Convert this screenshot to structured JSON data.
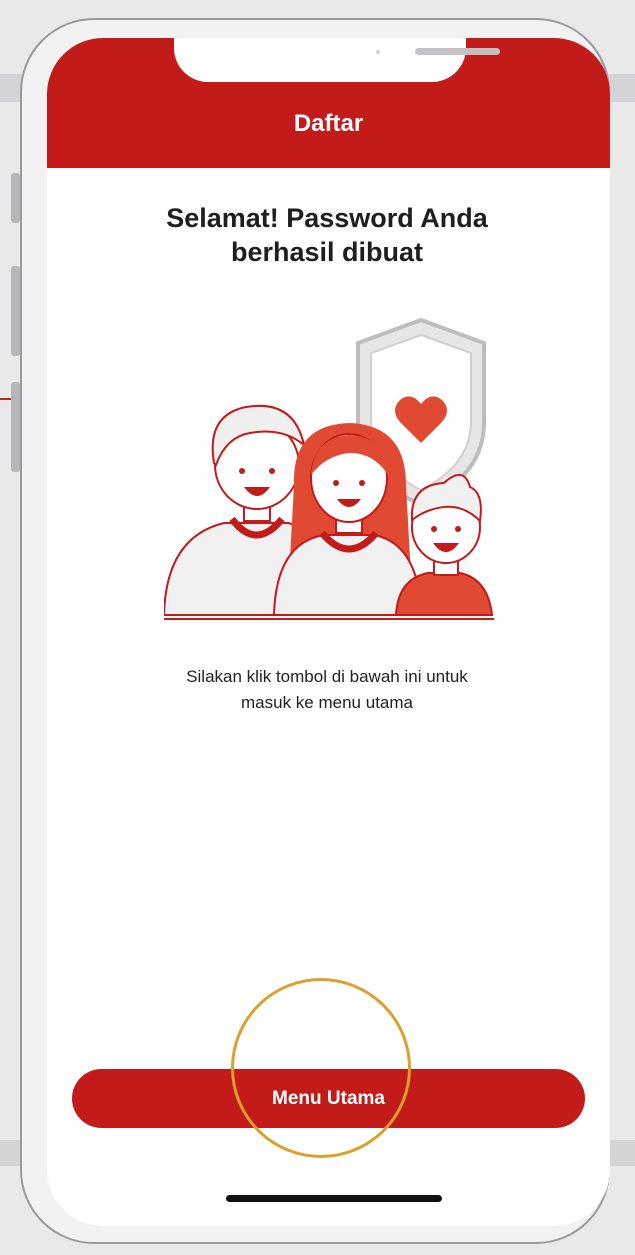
{
  "header": {
    "title": "Daftar"
  },
  "content": {
    "title_line1": "Selamat! Password Anda",
    "title_line2": "berhasil dibuat",
    "instruction_line1": "Silakan klik tombol di bawah ini untuk",
    "instruction_line2": "masuk ke menu utama"
  },
  "cta": {
    "label": "Menu Utama"
  },
  "colors": {
    "brand_red": "#c31a1a",
    "highlight_ring": "#dba12a",
    "background": "#e9e9ea"
  },
  "illustration": {
    "icon": "family-shield-heart-illustration"
  }
}
